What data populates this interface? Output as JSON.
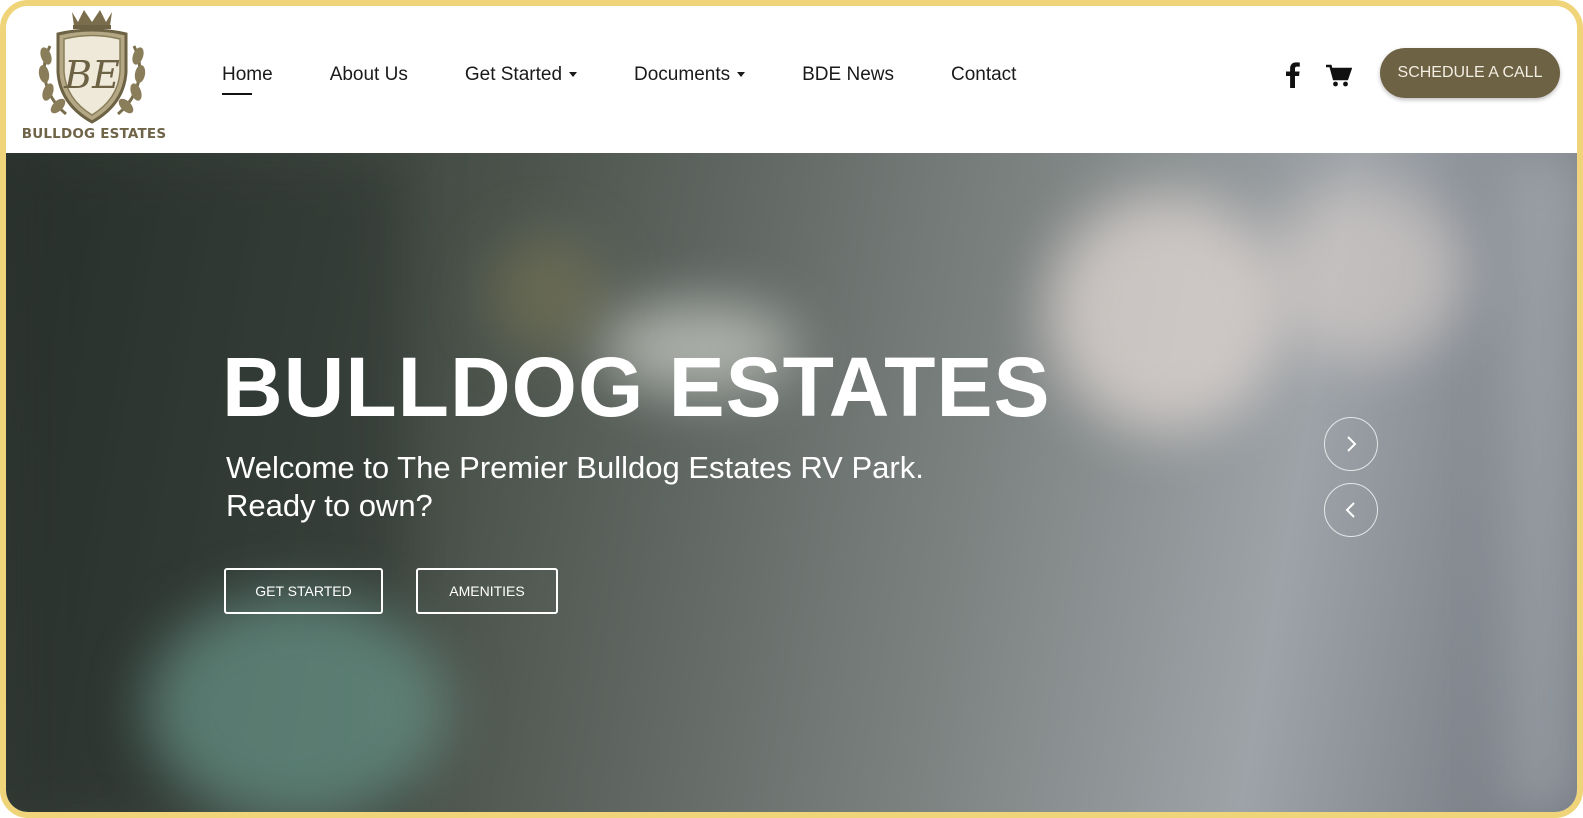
{
  "brand": {
    "monogram": "BE",
    "name": "BULLDOG ESTATES"
  },
  "nav": {
    "items": [
      {
        "label": "Home",
        "active": true,
        "dropdown": false
      },
      {
        "label": "About Us",
        "active": false,
        "dropdown": false
      },
      {
        "label": "Get Started",
        "active": false,
        "dropdown": true
      },
      {
        "label": "Documents",
        "active": false,
        "dropdown": true
      },
      {
        "label": "BDE News",
        "active": false,
        "dropdown": false
      },
      {
        "label": "Contact",
        "active": false,
        "dropdown": false
      }
    ]
  },
  "header_actions": {
    "facebook_icon": "facebook-icon",
    "cart_icon": "cart-icon",
    "cta_label": "SCHEDULE A CALL"
  },
  "hero": {
    "title": "BULLDOG ESTATES",
    "subtitle_line1": "Welcome to The Premier Bulldog Estates RV Park.",
    "subtitle_line2": "Ready to own?",
    "primary_button": "GET STARTED",
    "secondary_button": "AMENITIES",
    "next_icon": "chevron-right-icon",
    "prev_icon": "chevron-left-icon"
  },
  "colors": {
    "frame_border": "#f0d47a",
    "brand_gold": "#6e6245",
    "nav_text": "#1a1a1a",
    "hero_text": "#ffffff"
  }
}
